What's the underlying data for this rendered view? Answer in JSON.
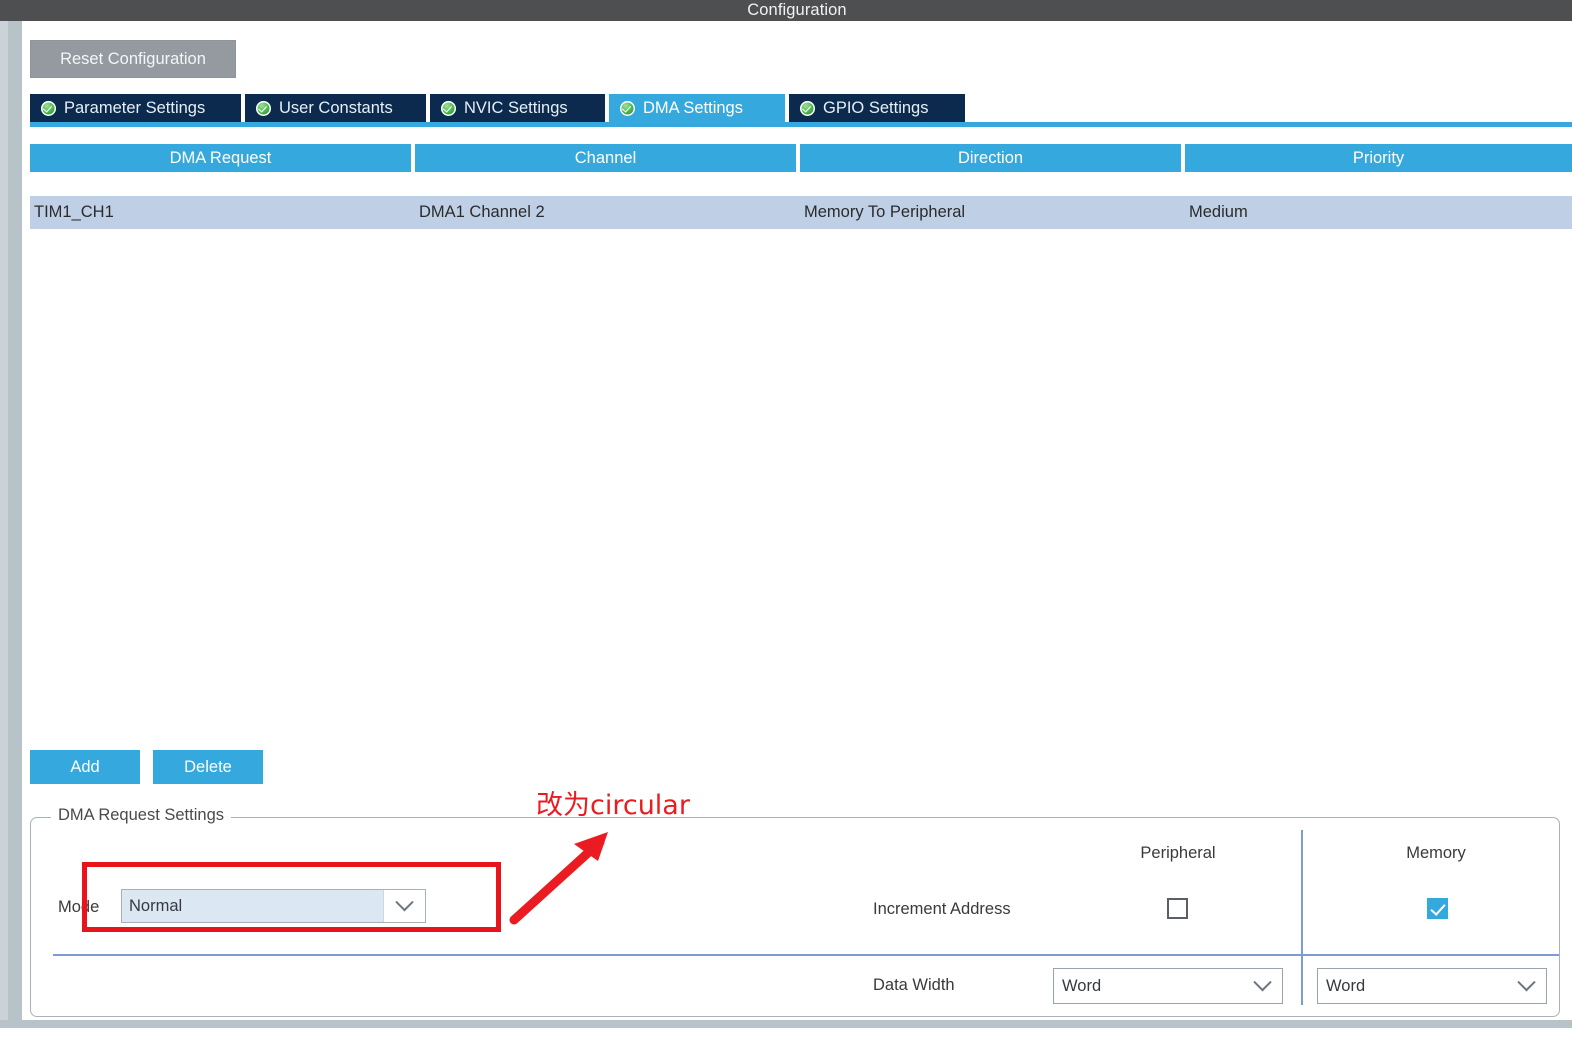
{
  "window": {
    "title": "Configuration"
  },
  "toolbar": {
    "reset_label": "Reset Configuration"
  },
  "tabs": [
    {
      "label": "Parameter Settings",
      "icon": "check-circle-icon",
      "active": false
    },
    {
      "label": "User Constants",
      "icon": "check-circle-icon",
      "active": false
    },
    {
      "label": "NVIC Settings",
      "icon": "check-circle-icon",
      "active": false
    },
    {
      "label": "DMA Settings",
      "icon": "check-circle-icon",
      "active": true
    },
    {
      "label": "GPIO Settings",
      "icon": "check-circle-icon",
      "active": false
    }
  ],
  "table": {
    "columns": [
      "DMA Request",
      "Channel",
      "Direction",
      "Priority"
    ],
    "rows": [
      {
        "dma_request": "TIM1_CH1",
        "channel": "DMA1 Channel 2",
        "direction": "Memory To Peripheral",
        "priority": "Medium"
      }
    ]
  },
  "actions": {
    "add_label": "Add",
    "delete_label": "Delete"
  },
  "settings": {
    "group_title": "DMA Request Settings",
    "mode_label": "Mode",
    "mode_value": "Normal",
    "column_headers": {
      "peripheral": "Peripheral",
      "memory": "Memory"
    },
    "increment_address": {
      "label": "Increment Address",
      "peripheral_checked": false,
      "memory_checked": true
    },
    "data_width": {
      "label": "Data Width",
      "peripheral_value": "Word",
      "memory_value": "Word"
    }
  },
  "annotation": {
    "text": "改为circular",
    "color": "#ea1c22"
  },
  "colors": {
    "accent_blue": "#35a8dd",
    "tab_navy": "#0b2a4e",
    "row_selected": "#bfd0e6",
    "titlebar": "#4d4f50",
    "divider_blue": "#7f9ad4",
    "annotation_red": "#ea1c22"
  }
}
